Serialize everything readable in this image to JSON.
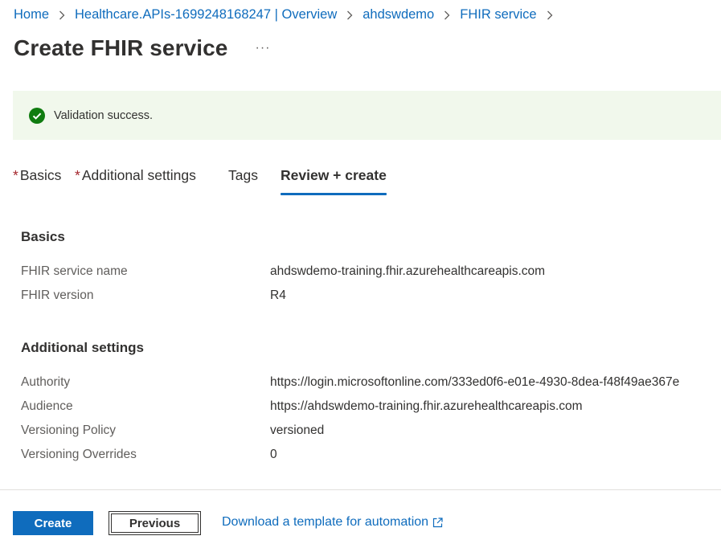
{
  "breadcrumb": {
    "items": [
      "Home",
      "Healthcare.APIs-1699248168247 | Overview",
      "ahdswdemo",
      "FHIR service"
    ]
  },
  "page": {
    "title": "Create FHIR service",
    "more_label": "···"
  },
  "banner": {
    "text": "Validation success.",
    "status_color": "#107c10"
  },
  "tabs": [
    {
      "label": "Basics",
      "required_mark": "*"
    },
    {
      "label": "Additional settings",
      "required_mark": "*"
    },
    {
      "label": "Tags",
      "required_mark": ""
    },
    {
      "label": "Review + create",
      "required_mark": "",
      "active": true
    }
  ],
  "review": {
    "basics": {
      "title": "Basics",
      "rows": [
        {
          "label": "FHIR service name",
          "value": "ahdswdemo-training.fhir.azurehealthcareapis.com"
        },
        {
          "label": "FHIR version",
          "value": "R4"
        }
      ]
    },
    "additional": {
      "title": "Additional settings",
      "rows": [
        {
          "label": "Authority",
          "value": "https://login.microsoftonline.com/333ed0f6-e01e-4930-8dea-f48f49ae367e"
        },
        {
          "label": "Audience",
          "value": "https://ahdswdemo-training.fhir.azurehealthcareapis.com"
        },
        {
          "label": "Versioning Policy",
          "value": "versioned"
        },
        {
          "label": "Versioning Overrides",
          "value": "0"
        }
      ]
    }
  },
  "footer": {
    "create_label": "Create",
    "previous_label": "Previous",
    "template_link": "Download a template for automation"
  },
  "colors": {
    "accent": "#0f6cbd",
    "banner_bg": "#f1f8ec",
    "required": "#a4262c"
  },
  "icons": {
    "status": "checkmark-circle-icon",
    "breadcrumb_separator": "chevron-right-icon",
    "external_link": "open-in-new-icon"
  }
}
